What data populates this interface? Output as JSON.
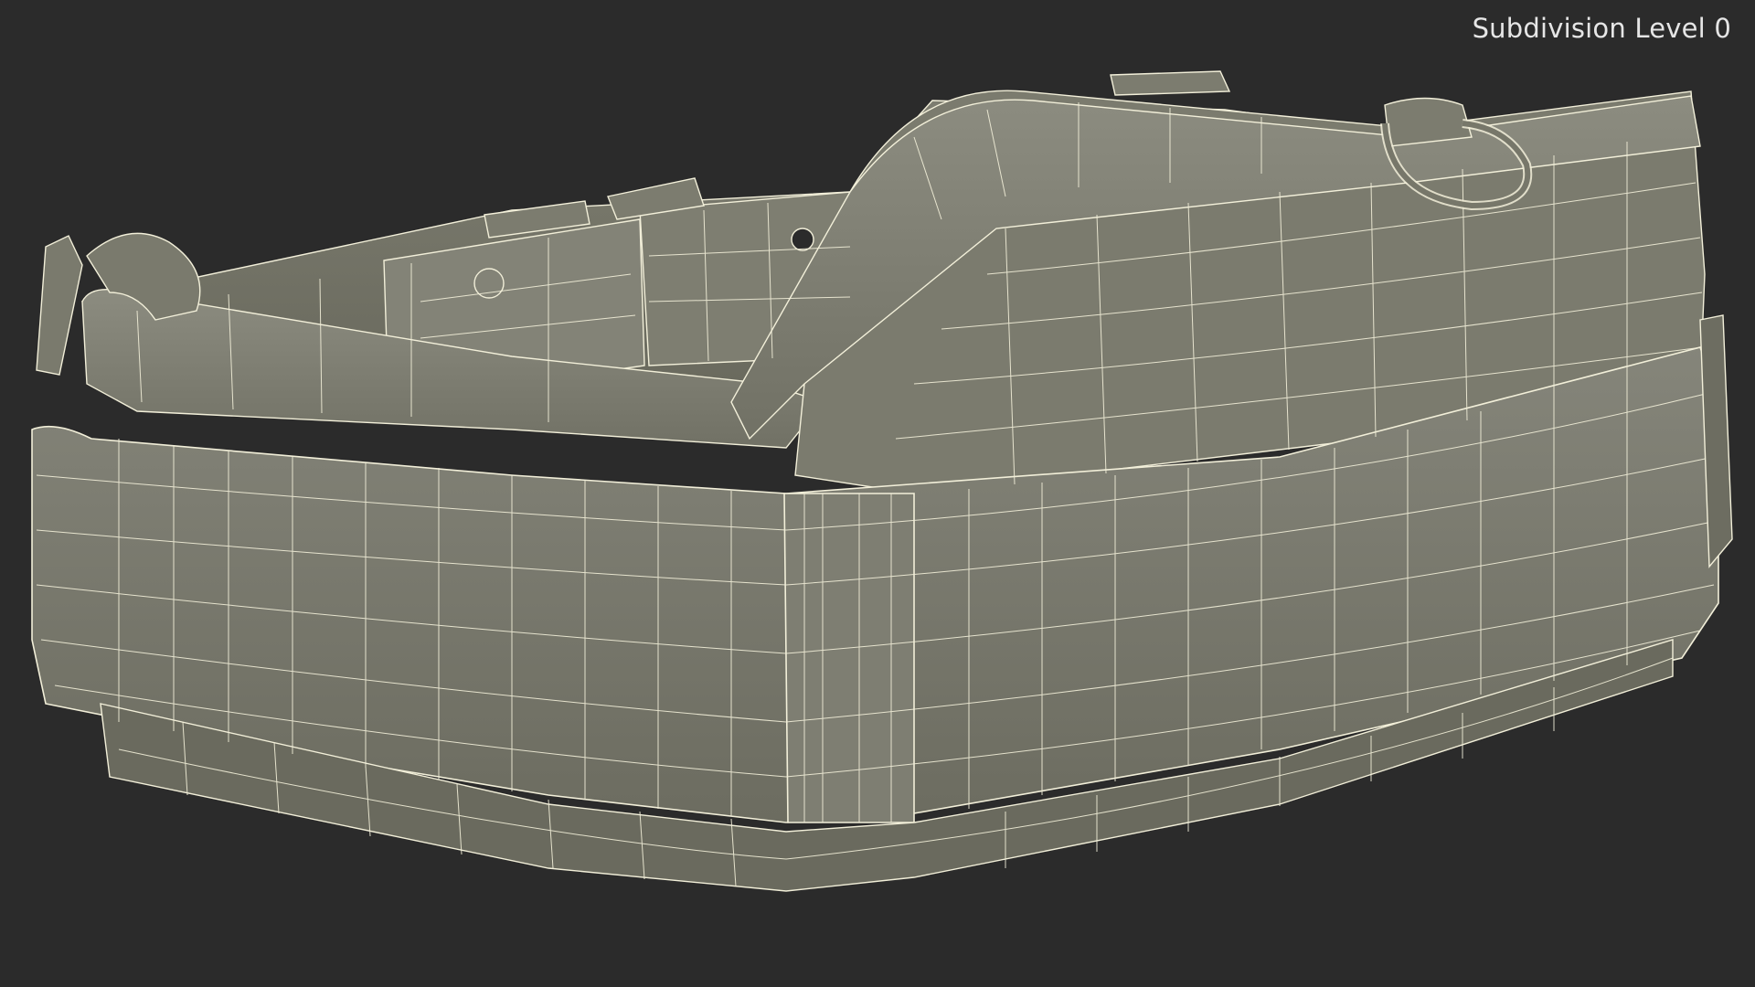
{
  "overlay": {
    "subdivision_label": "Subdivision Level 0"
  },
  "render": {
    "subject": "belt-wireframe",
    "background_color": "#2b2b2b",
    "surface_color": "#7b7b6c",
    "surface_dark_color": "#5f5f53",
    "wire_color": "#f2efd9"
  }
}
